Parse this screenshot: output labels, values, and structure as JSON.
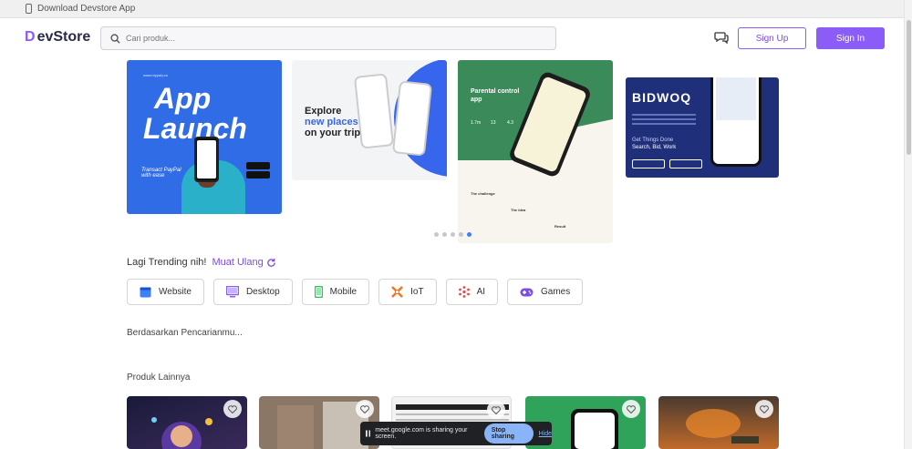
{
  "topbar": {
    "download_label": "Download Devstore App"
  },
  "header": {
    "logo_mark": "D",
    "logo_text": "evStore",
    "search_placeholder": "Cari produk...",
    "signup_label": "Sign Up",
    "signin_label": "Sign In"
  },
  "banners": [
    {
      "name": "app-launch",
      "headline_1": "App",
      "headline_2": "Launch",
      "tagline": "Transact PayPal with ease",
      "site": "www.mypaly.co"
    },
    {
      "name": "travel-app",
      "headline_1": "Explore",
      "headline_2": "new places",
      "headline_3": "on your trip"
    },
    {
      "name": "parental-control",
      "title": "Parental control app",
      "stats": [
        "1.7m",
        "13",
        "4.3"
      ],
      "challenge": "The challenge",
      "idea": "The idea",
      "result": "Result"
    },
    {
      "name": "bidwoq",
      "logo": "BIDWOQ",
      "tagline": "Get Things Done",
      "tagline2": "Search, Bid, Work"
    }
  ],
  "carousel": {
    "total": 5,
    "active_index": 4
  },
  "trending": {
    "label": "Lagi Trending nih!",
    "reload_label": "Muat Ulang"
  },
  "categories": [
    {
      "label": "Website",
      "icon": "website-icon",
      "color": "#3b82f6"
    },
    {
      "label": "Desktop",
      "icon": "desktop-icon",
      "color": "#8b5cf6"
    },
    {
      "label": "Mobile",
      "icon": "mobile-icon",
      "color": "#22c55e"
    },
    {
      "label": "IoT",
      "icon": "iot-icon",
      "color": "#f97316"
    },
    {
      "label": "AI",
      "icon": "ai-icon",
      "color": "#ef4444"
    },
    {
      "label": "Games",
      "icon": "games-icon",
      "color": "#7c4ce8"
    }
  ],
  "sections": {
    "search_based": "Berdasarkan Pencarianmu...",
    "other_products": "Produk Lainnya"
  },
  "screen_share": {
    "message": "meet.google.com is sharing your screen.",
    "stop_label": "Stop sharing",
    "hide_label": "Hide"
  },
  "colors": {
    "accent": "#8b5cf6",
    "link": "#7c4ce8"
  }
}
